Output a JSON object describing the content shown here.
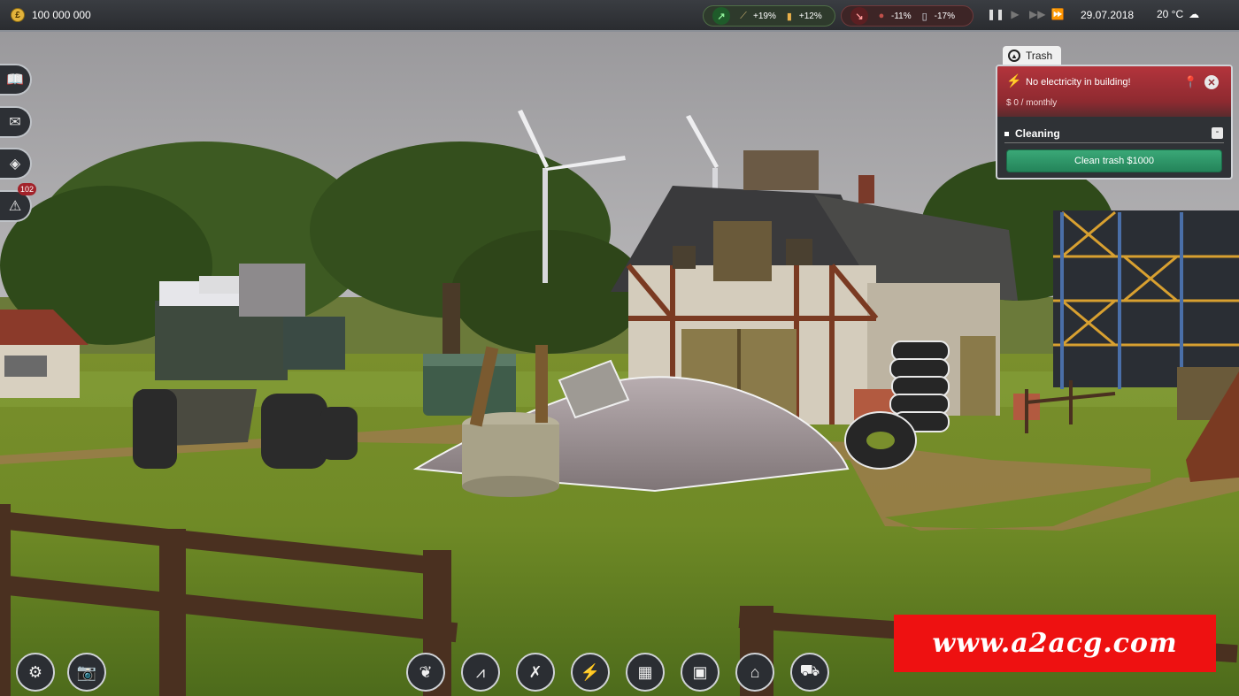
{
  "topbar": {
    "money": "100 000 000",
    "coin_symbol": "£",
    "positive_stats": [
      {
        "icon": "wheat-icon",
        "value": "+19%"
      },
      {
        "icon": "honey-jar-icon",
        "value": "+12%"
      }
    ],
    "negative_stats": [
      {
        "icon": "meat-icon",
        "value": "-11%"
      },
      {
        "icon": "milk-bottle-icon",
        "value": "-17%"
      }
    ],
    "date": "29.07.2018",
    "temperature": "20 °C",
    "weather_icon": "rain-cloud-icon"
  },
  "left_rail": {
    "items": [
      {
        "icon": "book-icon"
      },
      {
        "icon": "mail-icon"
      },
      {
        "icon": "layers-icon"
      },
      {
        "icon": "warning-icon"
      }
    ],
    "alert_count": "102"
  },
  "panel": {
    "tab_label": "Trash",
    "alert_title": "No electricity in building!",
    "alert_cost": "$ 0 / monthly",
    "section_title": "Cleaning",
    "collapse_symbol": "-",
    "action_label": "Clean trash $1000",
    "colors": {
      "alert": "#b3343c",
      "action": "#2f9a6a"
    }
  },
  "bottom_toolbar": {
    "left": [
      {
        "icon": "settings-gear-icon"
      },
      {
        "icon": "camera-icon"
      }
    ],
    "center": [
      {
        "icon": "fertilizer-icon"
      },
      {
        "icon": "road-icon"
      },
      {
        "icon": "demolish-icon"
      },
      {
        "icon": "power-pylon-icon"
      },
      {
        "icon": "shop-icon"
      },
      {
        "icon": "machine-icon"
      },
      {
        "icon": "building-upgrade-icon"
      },
      {
        "icon": "tractor-icon"
      }
    ]
  },
  "watermark": "www.a2acg.com"
}
